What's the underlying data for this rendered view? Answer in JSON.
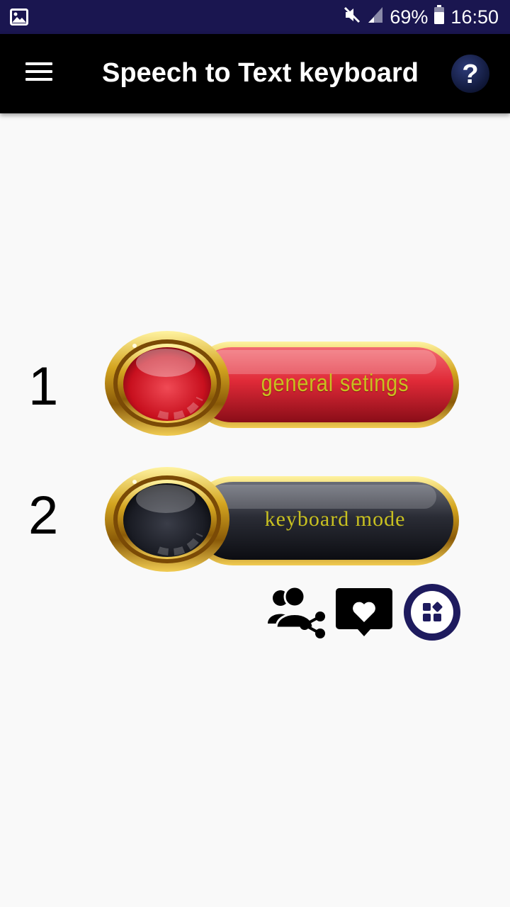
{
  "status_bar": {
    "battery": "69%",
    "time": "16:50",
    "icons": [
      "gallery-icon",
      "mute-icon",
      "signal-icon",
      "battery-icon"
    ]
  },
  "app_bar": {
    "title": "Speech to Text keyboard",
    "icons": [
      "menu-icon",
      "help-icon"
    ]
  },
  "steps": [
    {
      "number": "1",
      "label": "general setings",
      "color": "#d8232f"
    },
    {
      "number": "2",
      "label": "keyboard mode",
      "color": "#1c1d24"
    }
  ],
  "actions": [
    "share-users-icon",
    "heart-message-icon",
    "apps-grid-icon"
  ],
  "colors": {
    "status_bar": "#1a1650",
    "app_bar": "#000000",
    "background": "#f9f9f9",
    "gold": "#d4a520",
    "label_text": "#c8c020",
    "apps_circle": "#1e1b5e"
  }
}
